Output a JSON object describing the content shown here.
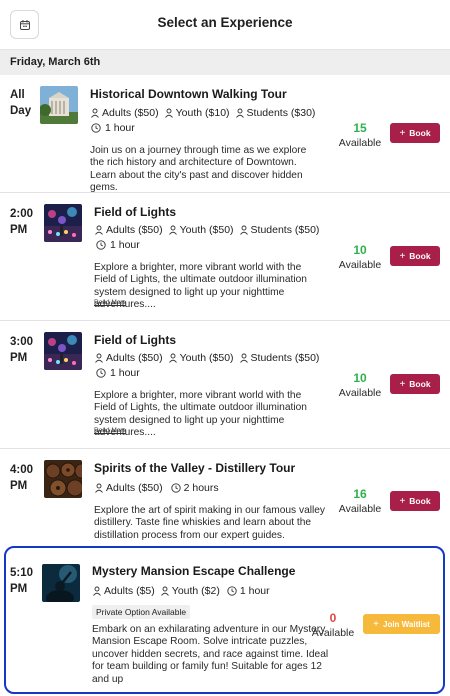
{
  "header": {
    "title": "Select an Experience",
    "calendar_icon": "calendar-icon"
  },
  "date_bar": {
    "label": "Friday, March 6th"
  },
  "colors": {
    "book_button": "#a8204a",
    "waitlist_button": "#f6b93b",
    "available_green": "#2fb24c",
    "available_zero": "#e04545",
    "highlight_border": "#1538c8"
  },
  "experiences": [
    {
      "time_line1": "All",
      "time_line2": "Day",
      "title": "Historical Downtown Walking Tour",
      "prices": [
        "Adults ($50)",
        "Youth ($10)",
        "Students ($30)"
      ],
      "duration": "1 hour",
      "description": "Join us on a journey through time as we explore the rich history and architecture of Downtown. Learn about the city's past and discover hidden gems.",
      "available_count": "15",
      "available_label": "Available",
      "button_label": "Book"
    },
    {
      "time_line1": "2:00",
      "time_line2": "PM",
      "title": "Field of Lights",
      "prices": [
        "Adults ($50)",
        "Youth ($50)",
        "Students ($50)"
      ],
      "duration": "1 hour",
      "description": "Explore a brighter, more vibrant world with the Field of Lights, the ultimate outdoor illumination system designed to light up your nighttime adventures....",
      "read_more": "Read More",
      "available_count": "10",
      "available_label": "Available",
      "button_label": "Book"
    },
    {
      "time_line1": "3:00",
      "time_line2": "PM",
      "title": "Field of Lights",
      "prices": [
        "Adults ($50)",
        "Youth ($50)",
        "Students ($50)"
      ],
      "duration": "1 hour",
      "description": "Explore a brighter, more vibrant world with the Field of Lights, the ultimate outdoor illumination system designed to light up your nighttime adventures....",
      "read_more": "Read More",
      "available_count": "10",
      "available_label": "Available",
      "button_label": "Book"
    },
    {
      "time_line1": "4:00",
      "time_line2": "PM",
      "title": "Spirits of the Valley - Distillery Tour",
      "prices": [
        "Adults ($50)"
      ],
      "duration": "2 hours",
      "description": "Explore the art of spirit making in our famous valley distillery. Taste fine whiskies and learn about the distillation process from our expert guides.",
      "available_count": "16",
      "available_label": "Available",
      "button_label": "Book"
    },
    {
      "time_line1": "5:10",
      "time_line2": "PM",
      "title": "Mystery Mansion Escape Challenge",
      "prices": [
        "Adults ($5)",
        "Youth ($2)"
      ],
      "duration": "1 hour",
      "badge": "Private Option Available",
      "description": "Embark on an exhilarating adventure in our Mystery Mansion Escape Room. Solve intricate puzzles, uncover hidden secrets, and race against time. Ideal for team building or family fun! Suitable for ages 12 and up",
      "available_count": "0",
      "available_label": "Available",
      "button_label": "Join Waitlist"
    }
  ]
}
